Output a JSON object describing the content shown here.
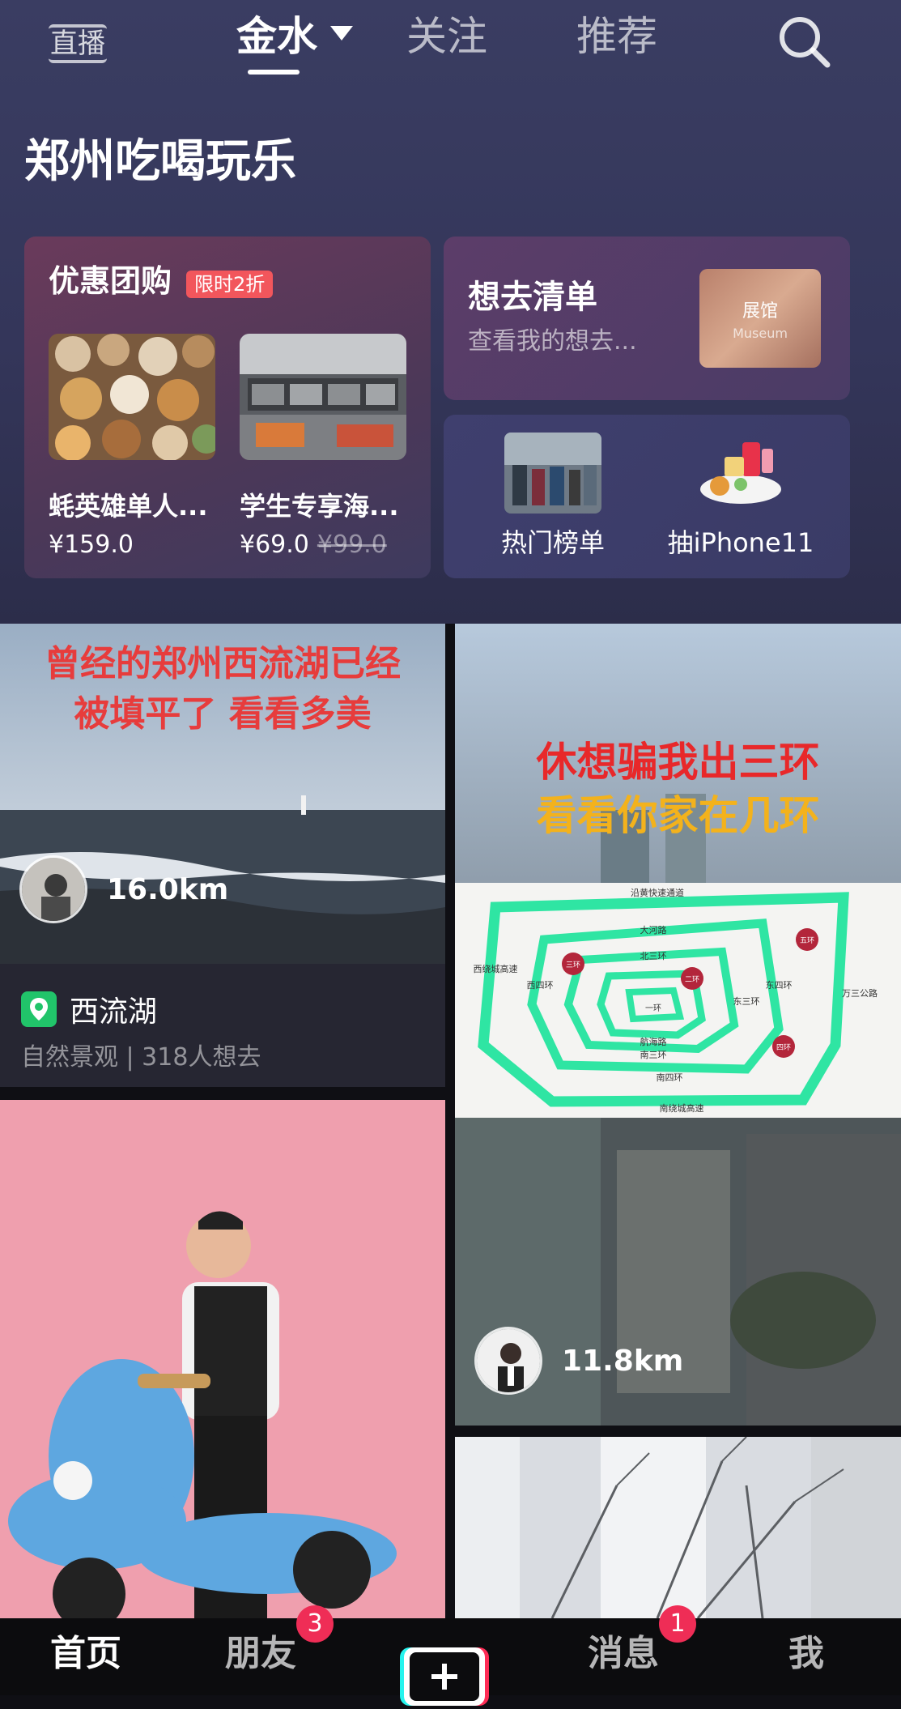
{
  "top_nav": {
    "live_label": "直播",
    "tabs": [
      {
        "label": "金水",
        "active": true
      },
      {
        "label": "关注",
        "active": false
      },
      {
        "label": "推荐",
        "active": false
      }
    ]
  },
  "section": {
    "title": "郑州吃喝玩乐"
  },
  "deal_card": {
    "title": "优惠团购",
    "badge": "限时2折",
    "items": [
      {
        "name": "蚝英雄单人...",
        "price": "¥159.0"
      },
      {
        "name": "学生专享海...",
        "price": "¥69.0",
        "old_price": "¥99.0"
      }
    ]
  },
  "wish_card": {
    "title": "想去清单",
    "subtitle": "查看我的想去...",
    "thumb_title": "展馆",
    "thumb_sub": "Museum"
  },
  "rank_card": {
    "items": [
      {
        "label": "热门榜单"
      },
      {
        "label": "抽iPhone11"
      }
    ]
  },
  "feed": [
    {
      "overlay_line1": "曾经的郑州西流湖已经",
      "overlay_line2": "被填平了 看看多美",
      "distance": "16.0km",
      "poi_name": "西流湖",
      "poi_meta": "自然景观 | 318人想去"
    },
    {
      "overlay_line1": "休想骗我出三环",
      "overlay_line2": "看看你家在几环",
      "distance": "11.8km",
      "map_labels": {
        "top": "沿黄快速通道",
        "r3": "三环",
        "r2": "二环",
        "r5": "五环",
        "r4": "四环",
        "daheroad": "大河路",
        "n3": "北三环",
        "s3": "南三环",
        "s4": "南四环",
        "e3": "东三环",
        "e4": "东四环",
        "w4": "西四环",
        "hang": "航海路",
        "south": "南绕城高速",
        "west": "西绕城高速",
        "wanshan": "万三公路",
        "r1": "一环"
      }
    },
    {
      "type": "video"
    },
    {
      "type": "video"
    }
  ],
  "bottom_nav": {
    "items": [
      {
        "label": "首页",
        "active": true
      },
      {
        "label": "朋友",
        "badge": "3"
      },
      {
        "label": "消息",
        "badge": "1"
      },
      {
        "label": "我"
      }
    ]
  },
  "colors": {
    "accent_red": "#ef2d56",
    "green_pin": "#21c46a",
    "badge_red": "#f2565c"
  }
}
